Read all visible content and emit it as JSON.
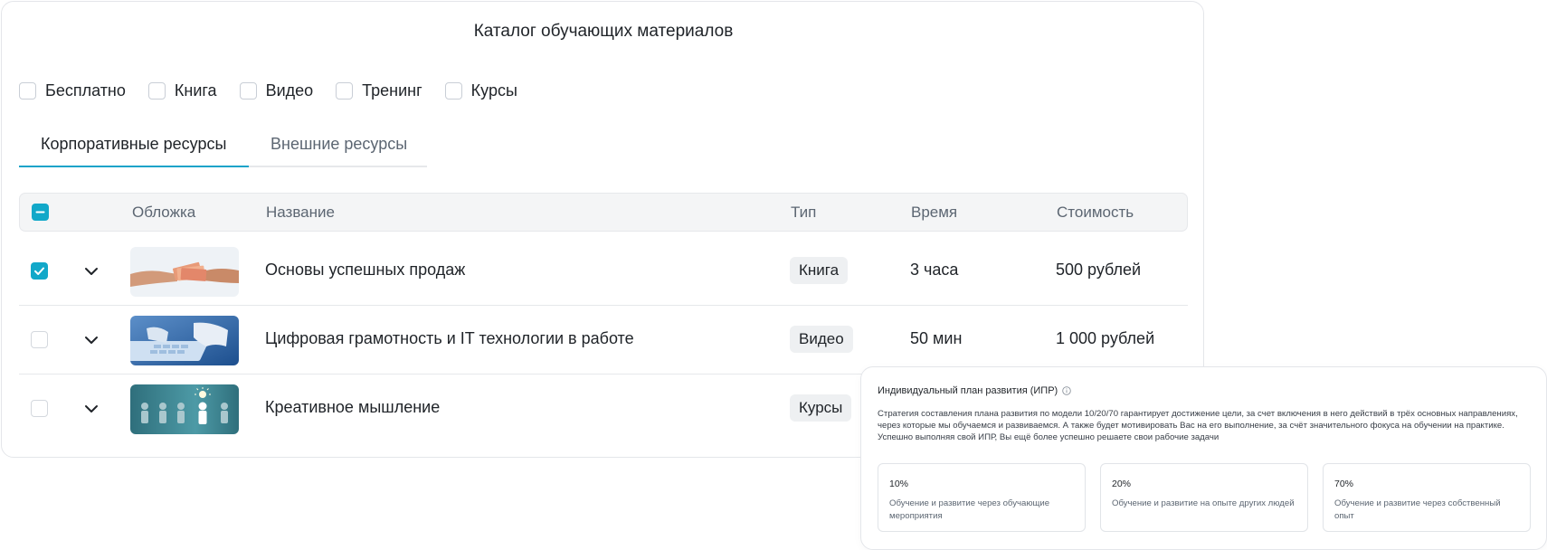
{
  "catalog": {
    "title": "Каталог обучающих материалов",
    "filters": [
      "Бесплатно",
      "Книга",
      "Видео",
      "Тренинг",
      "Курсы"
    ],
    "tabs": [
      {
        "label": "Корпоративные ресурсы",
        "active": true
      },
      {
        "label": "Внешние ресурсы",
        "active": false
      }
    ],
    "table": {
      "headers": {
        "cover": "Обложка",
        "name": "Название",
        "type": "Тип",
        "time": "Время",
        "cost": "Стоимость"
      },
      "rows": [
        {
          "checked": true,
          "name": "Основы успешных продаж",
          "type": "Книга",
          "time": "3 часа",
          "cost": "500 рублей",
          "cover_icon": "money-handover-image"
        },
        {
          "checked": false,
          "name": "Цифровая грамотность и IT технологии в работе",
          "type": "Видео",
          "time": "50 мин",
          "cost": "1 000 рублей",
          "cover_icon": "laptop-typing-image"
        },
        {
          "checked": false,
          "name": "Креативное мышление",
          "type": "Курсы",
          "time": "",
          "cost": "",
          "cover_icon": "idea-people-image"
        }
      ]
    }
  },
  "ipr": {
    "title": "Индивидуальный план развития (ИПР)",
    "description": "Стратегия составления плана развития по модели 10/20/70 гарантирует достижение цели, за счет включения в него действий в трёх основных направлениях, через которые мы обучаемся и развиваемся. А также будет мотивировать Вас на его выполнение, за счёт значительного фокуса на обучении на практике. Успешно выполняя свой ИПР, Вы ещё более успешно решаете свои рабочие задачи",
    "cards": [
      {
        "percent": "10%",
        "text": "Обучение и развитие через обучающие мероприятия"
      },
      {
        "percent": "20%",
        "text": "Обучение и развитие на опыте других людей"
      },
      {
        "percent": "70%",
        "text": "Обучение и развитие через собственный опыт"
      }
    ]
  },
  "colors": {
    "accent": "#12a8c9",
    "border": "#e6e8eb",
    "header_bg": "#f4f5f6",
    "badge_bg": "#eef0f2"
  }
}
